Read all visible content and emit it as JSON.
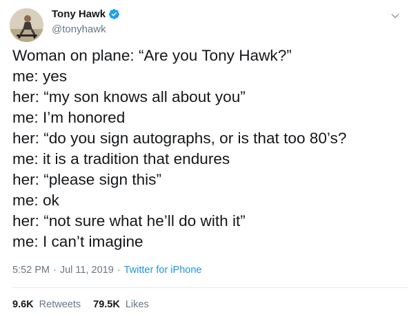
{
  "user": {
    "display_name": "Tony Hawk",
    "handle": "@tonyhawk",
    "verified": true
  },
  "tweet": {
    "lines": [
      "Woman on plane: “Are you Tony Hawk?”",
      "me: yes",
      "her: “my son knows all about you”",
      "me: I’m honored",
      "her: “do you sign autographs, or is that too 80’s?",
      "me: it is a tradition that endures",
      "her: “please sign this”",
      "me: ok",
      "her: “not sure what he’ll do with it”",
      "me: I can’t imagine"
    ]
  },
  "meta": {
    "time": "5:52 PM",
    "separator": "·",
    "date": "Jul 11, 2019",
    "source": "Twitter for iPhone"
  },
  "stats": {
    "retweets_count": "9.6K",
    "retweets_label": "Retweets",
    "likes_count": "79.5K",
    "likes_label": "Likes"
  },
  "colors": {
    "text": "#14171a",
    "secondary": "#657786",
    "accent": "#1b95e0",
    "verified": "#1da1f2"
  },
  "icons": {
    "verified": "verified-badge-icon",
    "caret": "chevron-down-icon"
  }
}
